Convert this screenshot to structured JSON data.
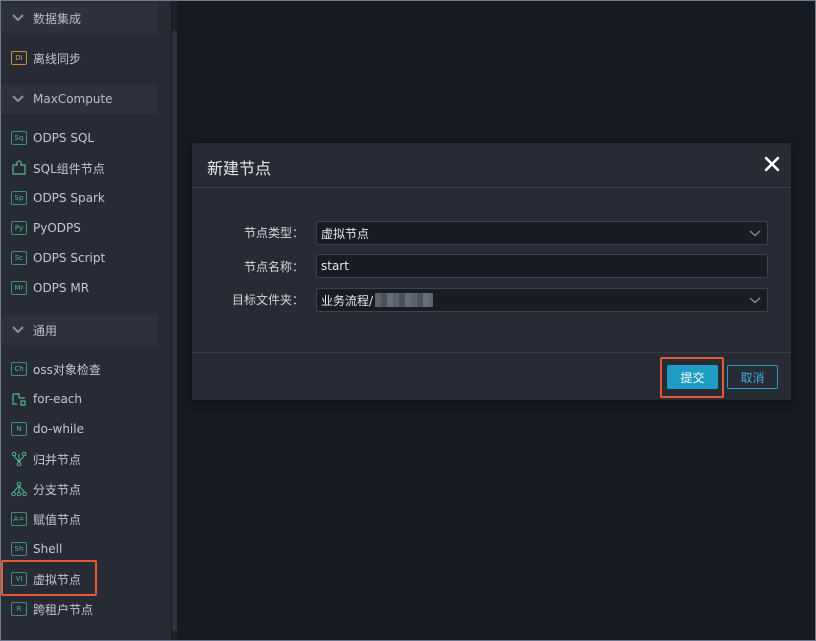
{
  "sidebar": {
    "groups": [
      {
        "label": "数据集成"
      },
      {
        "label": "MaxCompute"
      },
      {
        "label": "通用"
      }
    ],
    "items": [
      {
        "label": "离线同步",
        "badge": "DI",
        "icon": "di-icon"
      },
      {
        "label": "ODPS SQL",
        "badge": "Sq",
        "icon": "sql-icon"
      },
      {
        "label": "SQL组件节点",
        "icon": "puzzle-icon"
      },
      {
        "label": "ODPS Spark",
        "badge": "Sp",
        "icon": "spark-icon"
      },
      {
        "label": "PyODPS",
        "badge": "Py",
        "icon": "python-icon"
      },
      {
        "label": "ODPS Script",
        "badge": "Sc",
        "icon": "script-icon"
      },
      {
        "label": "ODPS MR",
        "badge": "Mr",
        "icon": "mapreduce-icon"
      },
      {
        "label": "oss对象检查",
        "badge": "Ch",
        "icon": "check-icon"
      },
      {
        "label": "for-each",
        "icon": "loop-icon"
      },
      {
        "label": "do-while",
        "badge": "N",
        "icon": "do-while-icon"
      },
      {
        "label": "归并节点",
        "icon": "merge-icon"
      },
      {
        "label": "分支节点",
        "icon": "branch-icon"
      },
      {
        "label": "赋值节点",
        "badge": "A=",
        "icon": "assign-icon"
      },
      {
        "label": "Shell",
        "badge": "Sh",
        "icon": "shell-icon"
      },
      {
        "label": "虚拟节点",
        "badge": "VI",
        "icon": "virtual-icon"
      },
      {
        "label": "跨租户节点",
        "badge": "R",
        "icon": "cross-tenant-icon"
      }
    ]
  },
  "modal": {
    "title": "新建节点",
    "fields": {
      "type_label": "节点类型：",
      "type_value": "虚拟节点",
      "name_label": "节点名称：",
      "name_value": "start",
      "folder_label": "目标文件夹：",
      "folder_value": "业务流程/"
    },
    "submit_label": "提交",
    "cancel_label": "取消"
  },
  "colors": {
    "accent": "#1e9cc4",
    "highlight": "#e35a33",
    "badge_green": "#57b39b",
    "badge_orange": "#e09a4e"
  }
}
